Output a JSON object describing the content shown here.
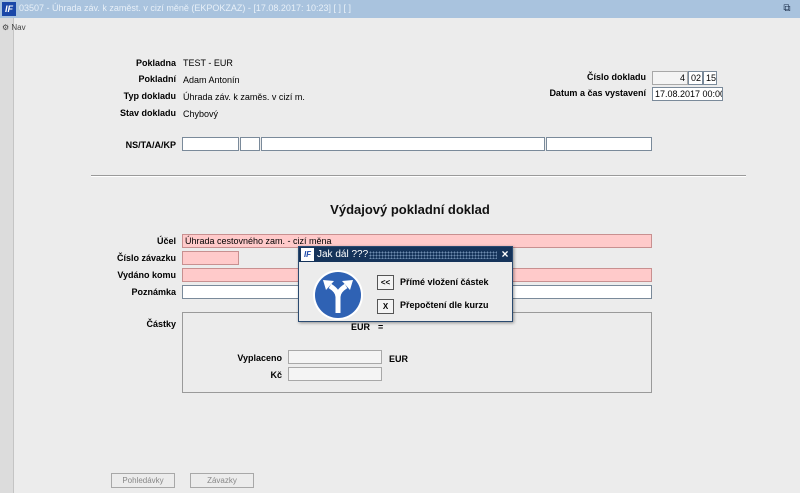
{
  "window": {
    "title": "03507 - Úhrada záv. k zaměst. v cizí měně (EKPOKZAZ) - [17.08.2017: 10:23]  [ ]  [ ]",
    "logo": "IF",
    "restore_icon": "restore-icon"
  },
  "nav": {
    "label": "Nav"
  },
  "form": {
    "pokladna": {
      "label": "Pokladna",
      "value": "TEST - EUR"
    },
    "pokladni": {
      "label": "Pokladní",
      "value": "Adam Antonín"
    },
    "typ": {
      "label": "Typ dokladu",
      "value": "Úhrada záv. k zaměs. v cizí m."
    },
    "stav": {
      "label": "Stav dokladu",
      "value": "Chybový"
    },
    "cislo": {
      "label": "Číslo dokladu",
      "parts": [
        "4",
        "02",
        "15"
      ]
    },
    "datum": {
      "label": "Datum a čas vystavení",
      "value": "17.08.2017 00:00"
    },
    "nstaakp": {
      "label": "NS/TA/A/KP",
      "values": [
        "",
        "",
        "",
        ""
      ]
    },
    "heading": "Výdajový pokladní doklad",
    "ucel": {
      "label": "Účel",
      "value": "Úhrada cestovného zam. - cizí měna"
    },
    "cislo_zavazku": {
      "label": "Číslo závazku",
      "value": ""
    },
    "vydano_komu": {
      "label": "Vydáno komu",
      "value": ""
    },
    "poznamka": {
      "label": "Poznámka",
      "value": ""
    },
    "castky": {
      "label": "Částky",
      "eur_label": "EUR",
      "equals": "=",
      "vyplaceno_label": "Vyplaceno",
      "vyplaceno_value": "",
      "vyplaceno_unit": "EUR",
      "kc_label": "Kč",
      "kc_value": ""
    }
  },
  "buttons": {
    "pohledavky": "Pohledávky",
    "zavazky": "Závazky"
  },
  "dialog": {
    "logo": "IF",
    "title": "Jak dál ???",
    "close": "×",
    "options": [
      {
        "key": "<<",
        "label": "Přímé vložení částek"
      },
      {
        "key": "X",
        "label": "Přepočtení dle kurzu"
      }
    ],
    "icon": "road-fork-icon"
  }
}
